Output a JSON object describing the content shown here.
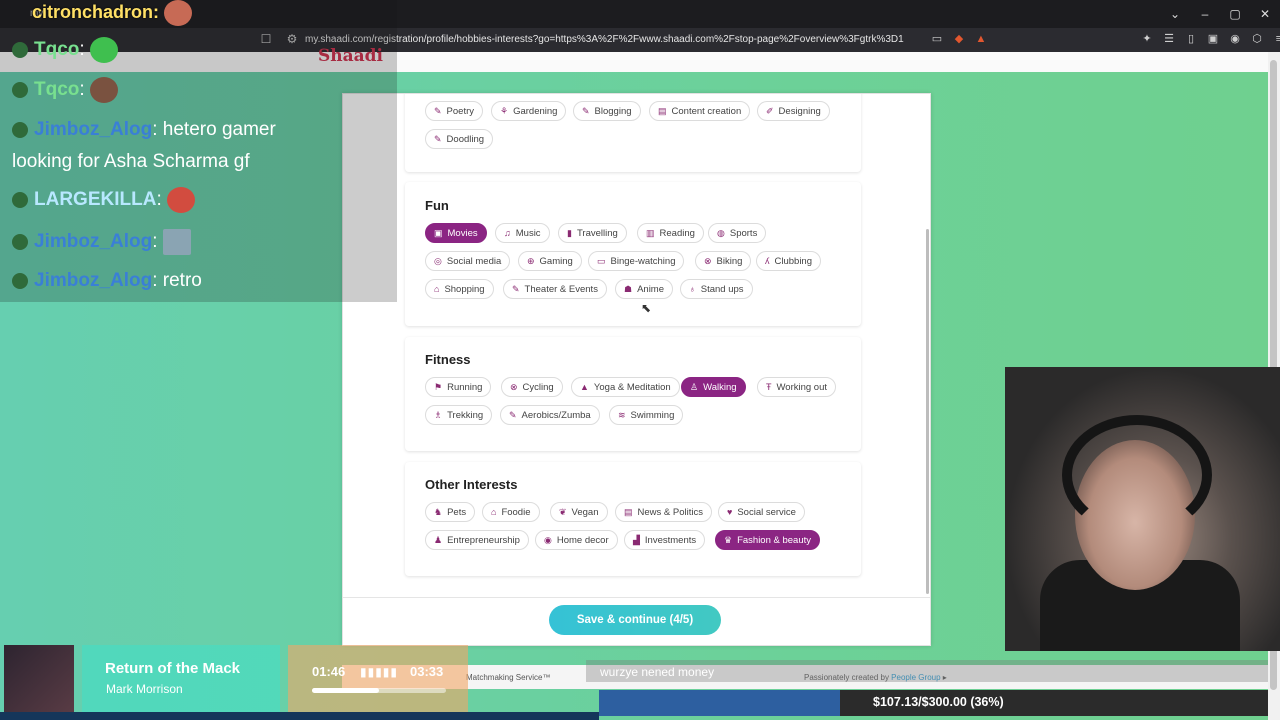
{
  "browser": {
    "tab_title": "my",
    "url": "my.shaadi.com/registration/profile/hobbies-interests?go=https%3A%2F%2Fwww.shaadi.com%2Fstop-page%2Foverview%3Fgtrk%3D1"
  },
  "site": {
    "logo": "Shaadi"
  },
  "sections": {
    "top": {
      "chips": [
        "Poetry",
        "Gardening",
        "Blogging",
        "Content creation",
        "Designing",
        "Doodling"
      ]
    },
    "fun": {
      "title": "Fun",
      "chips": [
        "Movies",
        "Music",
        "Travelling",
        "Reading",
        "Sports",
        "Social media",
        "Gaming",
        "Binge-watching",
        "Biking",
        "Clubbing",
        "Shopping",
        "Theater & Events",
        "Anime",
        "Stand ups"
      ],
      "selected": [
        "Movies"
      ]
    },
    "fitness": {
      "title": "Fitness",
      "chips": [
        "Running",
        "Cycling",
        "Yoga & Meditation",
        "Walking",
        "Working out",
        "Trekking",
        "Aerobics/Zumba",
        "Swimming"
      ],
      "selected": [
        "Walking"
      ]
    },
    "other": {
      "title": "Other Interests",
      "chips": [
        "Pets",
        "Foodie",
        "Vegan",
        "News & Politics",
        "Social service",
        "Entrepreneurship",
        "Home decor",
        "Investments",
        "Fashion & beauty"
      ],
      "selected": [
        "Fashion & beauty"
      ]
    }
  },
  "save_button": "Save & continue (4/5)",
  "footer": {
    "left": "Matchmaking Service™",
    "right_prefix": "Passionately created by",
    "right_link": "People Group"
  },
  "chat": [
    {
      "user": "citronchadron",
      "text": ":"
    },
    {
      "user": "Tqco",
      "text": ":"
    },
    {
      "user": "Tqco",
      "text": ":"
    },
    {
      "user": "Jimboz_Alog",
      "text": ": hetero gamer looking for Asha Scharma gf"
    },
    {
      "user": "LARGEKILLA",
      "text": ":"
    },
    {
      "user": "Jimboz_Alog",
      "text": ":"
    },
    {
      "user": "Jimboz_Alog",
      "text": ": retro"
    }
  ],
  "now_playing": {
    "title": "Return of the Mack",
    "artist": "Mark Morrison",
    "current": "01:46",
    "total": "03:33",
    "progress": 0.5
  },
  "ticker": "wurzye nened money",
  "goal": {
    "text": "$107.13/$300.00 (36%)",
    "progress": 0.36
  },
  "colors": {
    "selected_chip": "#8b2583",
    "save_button": "#35c2d6",
    "page_bg": "#6cd199"
  }
}
